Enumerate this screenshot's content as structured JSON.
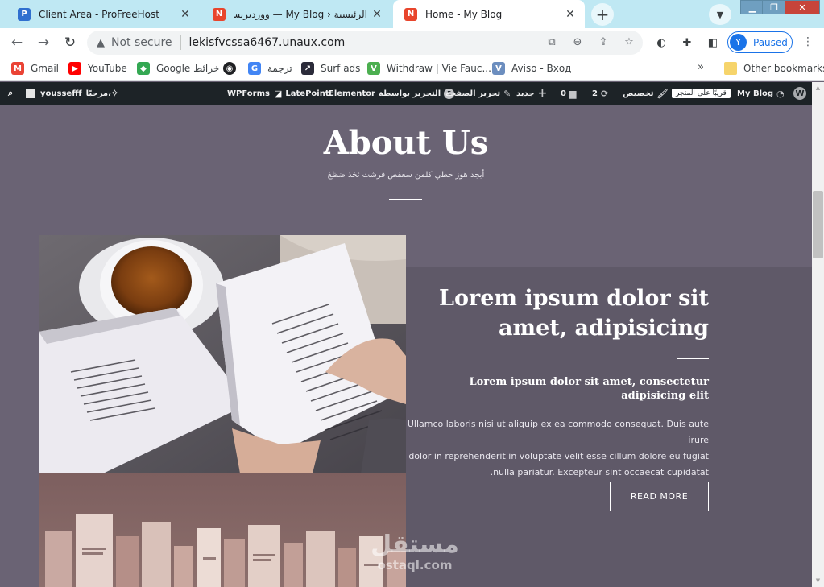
{
  "tabs": [
    {
      "title": "Client Area - ProFreeHost",
      "active": false
    },
    {
      "title": "الرئيسية ‹ My Blog — ووردبريس",
      "active": false
    },
    {
      "title": "Home - My Blog",
      "active": true
    }
  ],
  "address": {
    "security": "Not secure",
    "url": "lekisfvcssa6467.unaux.com"
  },
  "profile": {
    "initial": "Y",
    "status": "Paused"
  },
  "bookmarks": [
    {
      "label": "Gmail",
      "icon": "gmail-icon",
      "color": "#ea4335"
    },
    {
      "label": "YouTube",
      "icon": "youtube-icon",
      "color": "#ff0000"
    },
    {
      "label": "Google خرائط",
      "icon": "maps-icon",
      "color": "#34a853"
    },
    {
      "label": "",
      "icon": "globe-icon",
      "color": "#202124"
    },
    {
      "label": "ترجمة",
      "icon": "translate-icon",
      "color": "#4285f4"
    },
    {
      "label": "Surf ads",
      "icon": "surf-ads-icon",
      "color": "#2b2b3a"
    },
    {
      "label": "Withdraw | Vie Fauc...",
      "icon": "faucet-icon",
      "color": "#4caf50"
    },
    {
      "label": "Aviso - Вход",
      "icon": "aviso-icon",
      "color": "#6c8ebf"
    }
  ],
  "bookmarks_other": "Other bookmarks",
  "wpbar": {
    "user": "youssefff",
    "greeting": "مرحبًا،",
    "wpforms": "WPForms",
    "latepoint": "LatePoint",
    "elementor": "Elementor",
    "edit_with": "التحرير بواسطة",
    "edit_page": "تحرير الصفحة",
    "new": "جديد",
    "comments": "0",
    "updates": "2",
    "customize": "تخصيص",
    "store_soon": "قريبًا على المتجر",
    "site": "My Blog"
  },
  "content": {
    "about_title": "About Us",
    "about_sub": "أبجد هوز حطي كلمن سعفص قرشت ثخذ ضظغ",
    "hero_title_1": "Lorem ipsum dolor sit",
    "hero_title_2": "amet, adipisicing",
    "hero_sub_1": "Lorem ipsum dolor sit amet, consectetur",
    "hero_sub_2": "adipisicing elit",
    "body_1": "Ullamco laboris nisi ut aliquip ex ea commodo consequat. Duis aute irure",
    "body_2": "dolor in reprehenderit in voluptate velit esse cillum dolore eu fugiat",
    "body_3": ".nulla pariatur. Excepteur sint occaecat cupidatat",
    "read_more": "READ MORE"
  },
  "watermark": {
    "arabic": "مستقل",
    "latin": "ostaql.com"
  },
  "colors": {
    "tabstrip": "#bfe8f3",
    "page_bg": "#6a6374",
    "panel_bg": "#5f5968",
    "wpbar": "#1d2327",
    "accent": "#1a73e8"
  }
}
